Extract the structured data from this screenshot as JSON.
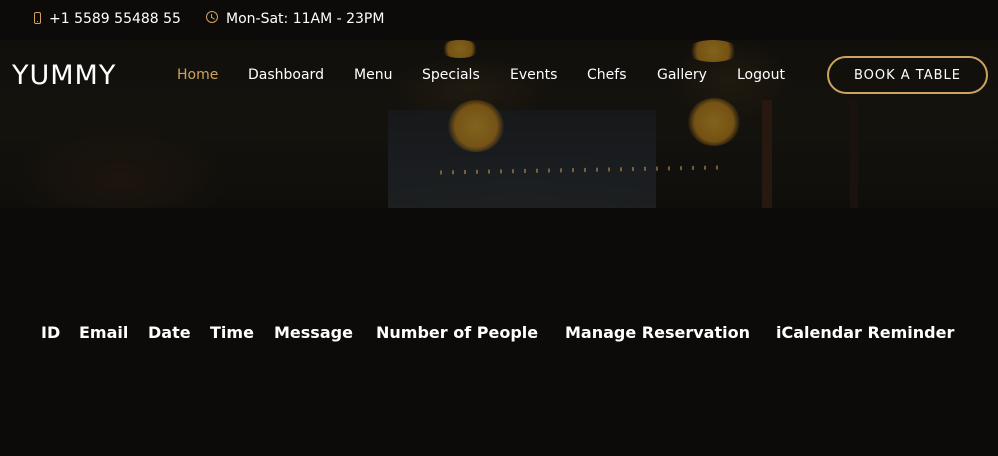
{
  "topbar": {
    "phone_icon": "phone-icon",
    "phone": "+1 5589 55488 55",
    "clock_icon": "clock-icon",
    "hours": "Mon-Sat: 11AM - 23PM"
  },
  "header": {
    "logo": "YUMMY",
    "nav": [
      {
        "label": "Home",
        "active": true
      },
      {
        "label": "Dashboard",
        "active": false
      },
      {
        "label": "Menu",
        "active": false
      },
      {
        "label": "Specials",
        "active": false
      },
      {
        "label": "Events",
        "active": false
      },
      {
        "label": "Chefs",
        "active": false
      },
      {
        "label": "Gallery",
        "active": false
      },
      {
        "label": "Logout",
        "active": false
      }
    ],
    "book_button": "BOOK A TABLE"
  },
  "reservations_table": {
    "columns": [
      "ID",
      "Email",
      "Date",
      "Time",
      "Message",
      "Number of People",
      "Manage Reservation",
      "iCalendar Reminder"
    ],
    "rows": []
  },
  "colors": {
    "accent": "#cda45e",
    "background": "#0c0b09",
    "text": "#ffffff"
  }
}
